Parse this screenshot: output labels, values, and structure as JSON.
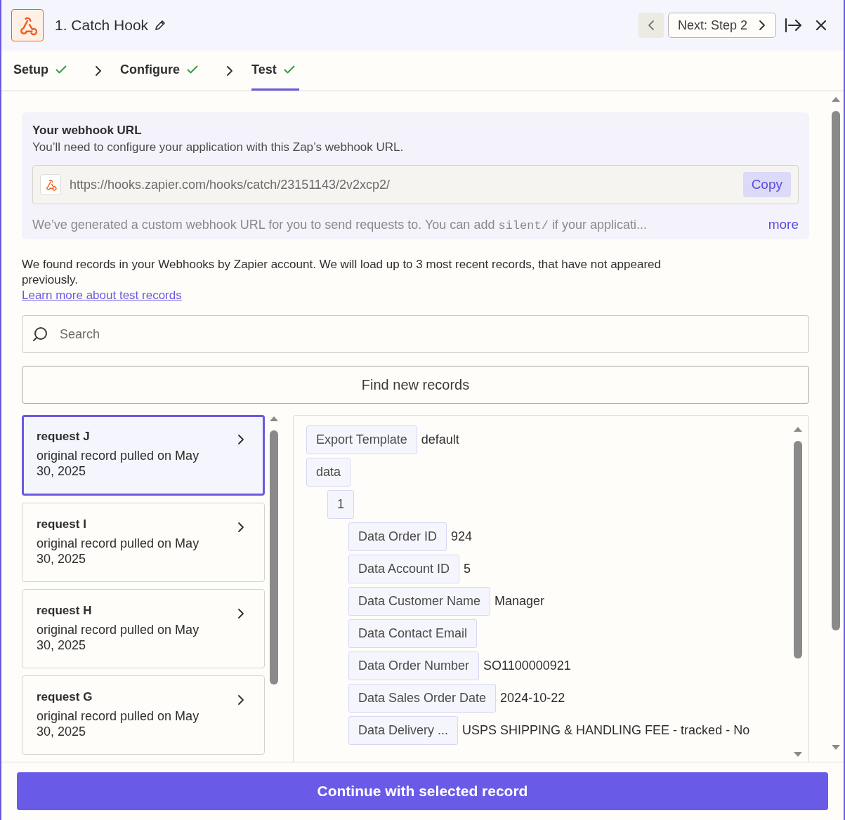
{
  "header": {
    "title": "1. Catch Hook",
    "next_button": "Next: Step 2"
  },
  "tabs": [
    {
      "label": "Setup",
      "done": true,
      "selected": false
    },
    {
      "label": "Configure",
      "done": true,
      "selected": false
    },
    {
      "label": "Test",
      "done": true,
      "selected": true
    }
  ],
  "webhook": {
    "title": "Your webhook URL",
    "subtitle": "You’ll need to configure your application with this Zap’s webhook URL.",
    "url": "https://hooks.zapier.com/hooks/catch/23151143/2v2xcp2/",
    "copy_button": "Copy",
    "note": {
      "before": "We’ve generated a custom webhook URL for you to send requests to. You can add",
      "code": "silent/",
      "after": "if your applicati..."
    },
    "more_link": "more"
  },
  "info": "We found records in your Webhooks by Zapier account. We will load up to 3 most recent records, that have not appeared previously.",
  "learn_link": "Learn more about test records",
  "search": {
    "placeholder": "Search"
  },
  "find_button": "Find new records",
  "records": [
    {
      "title": "request J",
      "subtitle": "original record pulled on May 30, 2025",
      "selected": true
    },
    {
      "title": "request I",
      "subtitle": "original record pulled on May 30, 2025",
      "selected": false
    },
    {
      "title": "request H",
      "subtitle": "original record pulled on May 30, 2025",
      "selected": false
    },
    {
      "title": "request G",
      "subtitle": "original record pulled on May 30, 2025",
      "selected": false
    }
  ],
  "fields": [
    {
      "key": "Export Template",
      "value": "default"
    },
    {
      "key": "data",
      "children": [
        {
          "key": "1",
          "children": [
            {
              "key": "Data Order ID",
              "value": "924"
            },
            {
              "key": "Data Account ID",
              "value": "5"
            },
            {
              "key": "Data Customer Name",
              "value": "Manager"
            },
            {
              "key": "Data Contact Email"
            },
            {
              "key": "Data Order Number",
              "value": "SO1100000921"
            },
            {
              "key": "Data Sales Order Date",
              "value": "2024-10-22"
            },
            {
              "key": "Data Delivery ...",
              "value": "USPS SHIPPING & HANDLING FEE - tracked - No"
            }
          ]
        }
      ]
    }
  ],
  "continue_button": "Continue with selected record"
}
